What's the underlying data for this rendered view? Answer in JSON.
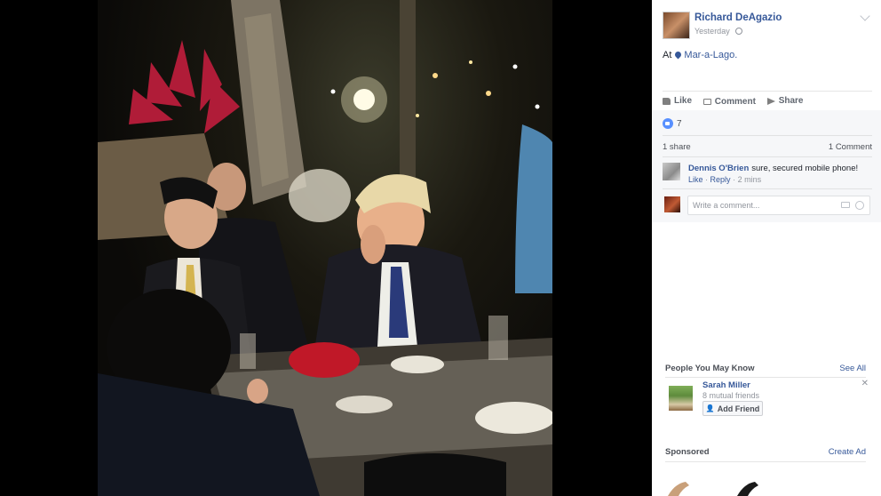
{
  "post": {
    "author": "Richard DeAgazio",
    "time": "Yesterday",
    "location_prefix": "At",
    "location": "Mar-a-Lago."
  },
  "actions": {
    "like": "Like",
    "comment": "Comment",
    "share": "Share"
  },
  "reactions": {
    "likes": "7",
    "shares": "1 share",
    "comments": "1 Comment"
  },
  "comment": {
    "author": "Dennis O'Brien",
    "text": "sure, secured mobile phone!",
    "like": "Like",
    "reply": "Reply",
    "time": "2 mins"
  },
  "comment_input": {
    "placeholder": "Write a comment..."
  },
  "people_you_may_know": {
    "title": "People You May Know",
    "see_all": "See All",
    "person": {
      "name": "Sarah Miller",
      "mutual": "8 mutual friends",
      "add_label": "Add Friend"
    }
  },
  "sponsored": {
    "title": "Sponsored",
    "create_ad": "Create Ad"
  },
  "icons": [
    "globe-icon",
    "chevron-down-icon",
    "location-pin-icon",
    "like-icon",
    "comment-icon",
    "share-icon",
    "camera-icon",
    "emoji-icon",
    "add-friend-icon",
    "close-icon"
  ],
  "colors": {
    "link": "#365899",
    "like_badge": "#5890ff",
    "panel_bg": "#ffffff",
    "viewer_bg": "#000000"
  }
}
